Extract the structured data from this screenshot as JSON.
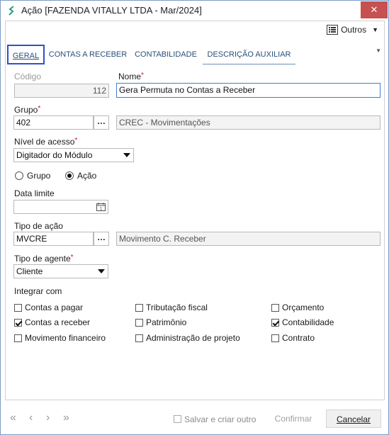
{
  "window": {
    "title": "Ação [FAZENDA VITALLY LTDA - Mar/2024]",
    "close_label": "✕"
  },
  "toolbar": {
    "outros_label": "Outros"
  },
  "tabs": [
    {
      "label": "GERAL"
    },
    {
      "label": "CONTAS A RECEBER"
    },
    {
      "label": "CONTABILIDADE"
    },
    {
      "label": "DESCRIÇÃO AUXILIAR"
    }
  ],
  "form": {
    "codigo": {
      "label": "Código",
      "value": "112"
    },
    "nome": {
      "label": "Nome",
      "value": "Gera Permuta no Contas a Receber"
    },
    "grupo": {
      "label": "Grupo",
      "code": "402",
      "description": "CREC - Movimentações"
    },
    "nivel_acesso": {
      "label": "Nível de acesso",
      "value": "Digitador do Módulo"
    },
    "tipo": {
      "option_grupo": "Grupo",
      "option_acao": "Ação",
      "selected": "Ação"
    },
    "data_limite": {
      "label": "Data limite",
      "value": ""
    },
    "tipo_acao": {
      "label": "Tipo de ação",
      "code": "MVCRE",
      "description": "Movimento C. Receber"
    },
    "tipo_agente": {
      "label": "Tipo de agente",
      "value": "Cliente"
    },
    "integrar": {
      "label": "Integrar com",
      "items": [
        {
          "label": "Contas a pagar",
          "checked": false
        },
        {
          "label": "Tributação fiscal",
          "checked": false
        },
        {
          "label": "Orçamento",
          "checked": false
        },
        {
          "label": "Contas a receber",
          "checked": true
        },
        {
          "label": "Patrimônio",
          "checked": false
        },
        {
          "label": "Contabilidade",
          "checked": true
        },
        {
          "label": "Movimento financeiro",
          "checked": false
        },
        {
          "label": "Administração de projeto",
          "checked": false
        },
        {
          "label": "Contrato",
          "checked": false
        }
      ]
    },
    "required_mark": "*"
  },
  "footer": {
    "salvar_criar_outro": "Salvar e criar outro",
    "confirmar": "Confirmar",
    "cancelar": "Cancelar"
  },
  "colors": {
    "accent": "#3050c8",
    "close": "#c75050",
    "required": "#d0161b"
  }
}
